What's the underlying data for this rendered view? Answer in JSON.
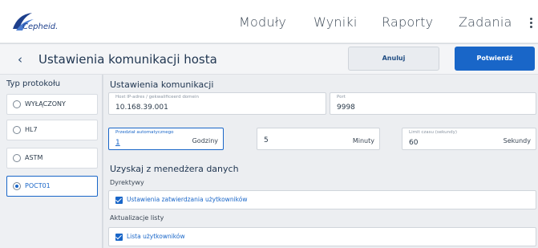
{
  "header": {
    "logo_text": "Cepheid.",
    "nav": [
      "Moduły",
      "Wyniki",
      "Raporty",
      "Zadania"
    ]
  },
  "titlebar": {
    "back_icon": "‹",
    "title": "Ustawienia komunikacji hosta",
    "cancel_label": "Anuluj",
    "confirm_label": "Potwierdź"
  },
  "sidebar": {
    "title": "Typ protokołu",
    "items": [
      {
        "label": "WYŁĄCZONY",
        "selected": false
      },
      {
        "label": "HL7",
        "selected": false
      },
      {
        "label": "ASTM",
        "selected": false
      },
      {
        "label": "POCT01",
        "selected": true
      }
    ]
  },
  "main": {
    "comm_title": "Ustawienia komunikacji",
    "host": {
      "label": "Host IP-adres / gekwalificeerd domein",
      "value": "10.168.39.001"
    },
    "port": {
      "label": "Port",
      "value": "9998"
    },
    "interval": {
      "label": "Przedział automatycznego",
      "value": "1",
      "unit": "Godziny"
    },
    "minutes": {
      "value": "5",
      "unit": "Minuty"
    },
    "limit": {
      "label": "Limit czasu (sekundy)",
      "value": "60",
      "unit": "Sekundy"
    },
    "data_manager_title": "Uzyskaj z menedżera danych",
    "directives_label": "Dyrektywy",
    "directives_item": {
      "label": "Ustawienia zatwierdzania użytkowników",
      "checked": true
    },
    "list_updates_label": "Aktualizacje listy",
    "list_item": {
      "label": "Lista użytkowników",
      "checked": true
    }
  },
  "colors": {
    "accent": "#1966c8",
    "nav_text": "#3e4a57",
    "brand": "#1d3f8c"
  }
}
